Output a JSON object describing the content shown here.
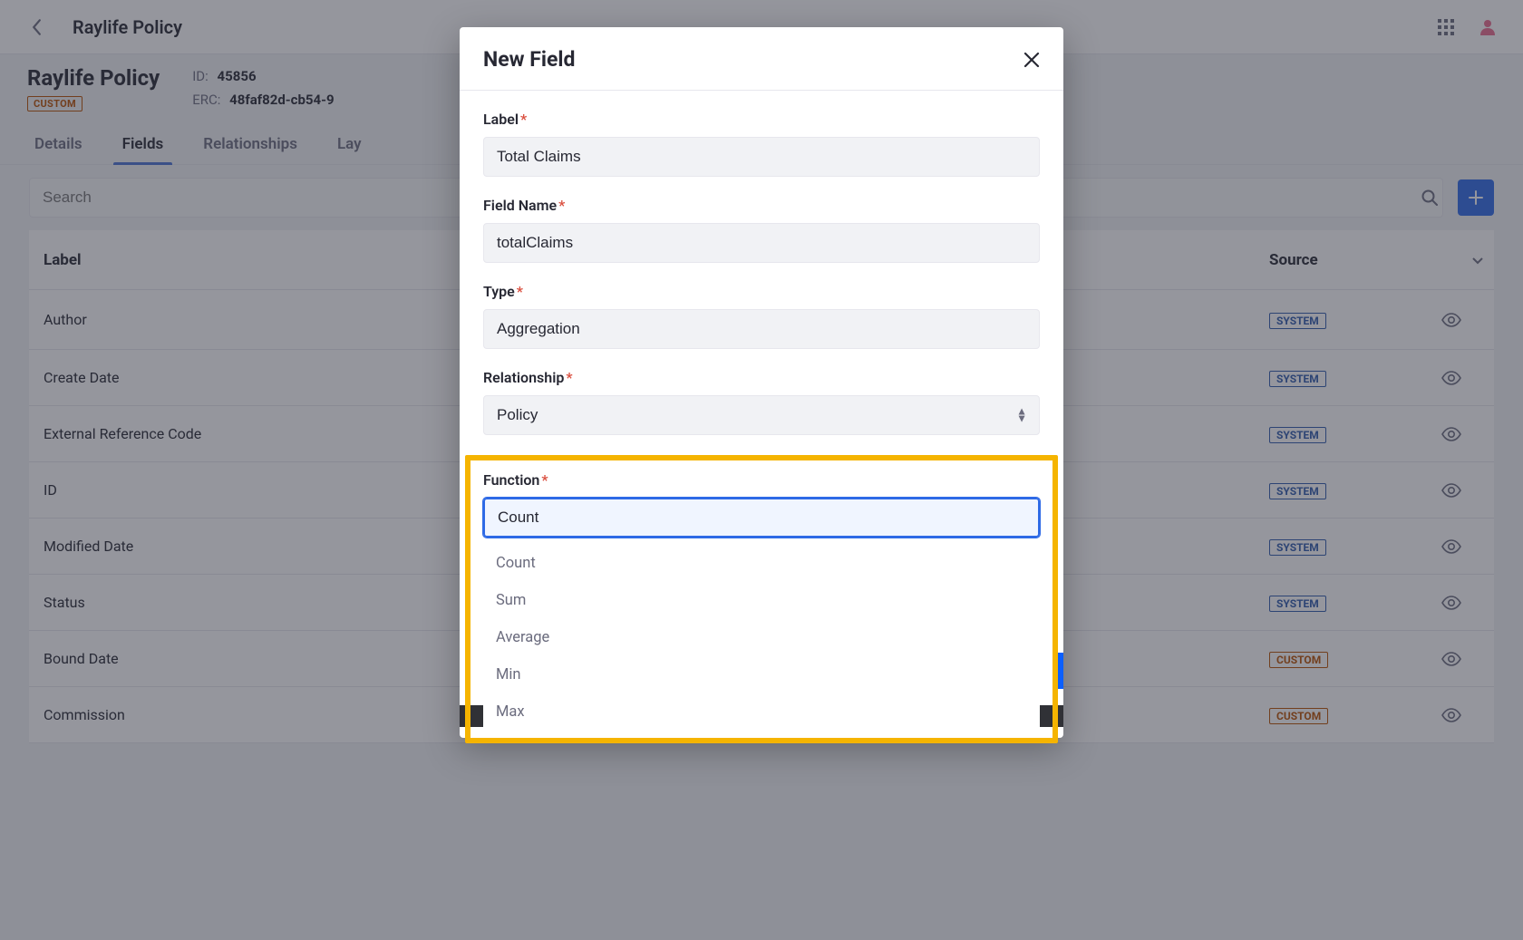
{
  "header": {
    "title": "Raylife Policy"
  },
  "page": {
    "title": "Raylife Policy",
    "badge": "CUSTOM",
    "meta": {
      "id_label": "ID:",
      "id_value": "45856",
      "erc_label": "ERC:",
      "erc_value": "48faf82d-cb54-9"
    }
  },
  "tabs": {
    "details": "Details",
    "fields": "Fields",
    "relationships": "Relationships",
    "layouts": "Lay"
  },
  "search": {
    "placeholder": "Search"
  },
  "table": {
    "header": {
      "label": "Label",
      "source": "Source"
    },
    "rows": [
      {
        "label": "Author",
        "source": "SYSTEM",
        "src_class": ""
      },
      {
        "label": "Create Date",
        "source": "SYSTEM",
        "src_class": ""
      },
      {
        "label": "External Reference Code",
        "source": "SYSTEM",
        "src_class": ""
      },
      {
        "label": "ID",
        "source": "SYSTEM",
        "src_class": ""
      },
      {
        "label": "Modified Date",
        "source": "SYSTEM",
        "src_class": ""
      },
      {
        "label": "Status",
        "source": "SYSTEM",
        "src_class": ""
      },
      {
        "label": "Bound Date",
        "source": "CUSTOM",
        "src_class": "custom-src"
      },
      {
        "label": "Commission",
        "source": "CUSTOM",
        "src_class": "custom-src"
      }
    ]
  },
  "modal": {
    "title": "New Field",
    "labels": {
      "label": "Label",
      "field_name": "Field Name",
      "type": "Type",
      "relationship": "Relationship",
      "function": "Function"
    },
    "values": {
      "label": "Total Claims",
      "field_name": "totalClaims",
      "type": "Aggregation",
      "relationship": "Policy",
      "function": "Count"
    },
    "function_options": [
      "Count",
      "Sum",
      "Average",
      "Min",
      "Max"
    ]
  }
}
